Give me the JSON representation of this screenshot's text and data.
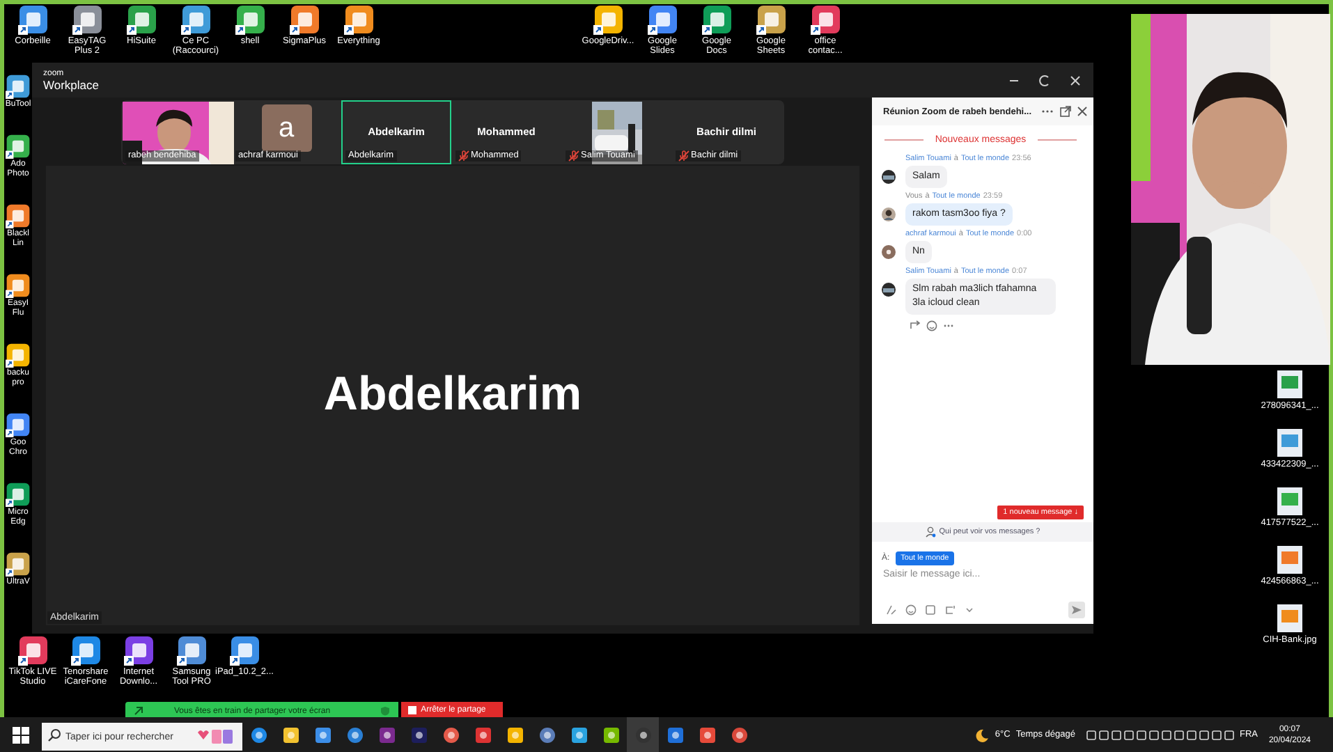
{
  "desktop": {
    "top_left_icons": [
      {
        "label": "Corbeille"
      },
      {
        "label": "EasyTAG Plus 2"
      },
      {
        "label": "HiSuite"
      },
      {
        "label": "Ce PC (Raccourci)"
      },
      {
        "label": "shell"
      },
      {
        "label": "SigmaPlus"
      },
      {
        "label": "Everything"
      }
    ],
    "top_right_icons": [
      {
        "label": "GoogleDriv..."
      },
      {
        "label": "Google Slides"
      },
      {
        "label": "Google Docs"
      },
      {
        "label": "Google Sheets"
      },
      {
        "label": "office contac..."
      }
    ],
    "left_icons": [
      {
        "label": "BuTool"
      },
      {
        "label": "Ado Photo"
      },
      {
        "label": "Blackl Lin"
      },
      {
        "label": "EasyI Flu"
      },
      {
        "label": "backu pro"
      },
      {
        "label": "Goo Chro"
      },
      {
        "label": "Micro Edg"
      },
      {
        "label": "UltraV"
      }
    ],
    "bottom_icons": [
      {
        "label": "TikTok LIVE Studio"
      },
      {
        "label": "Tenorshare iCareFone"
      },
      {
        "label": "Internet Downlo..."
      },
      {
        "label": "Samsung Tool PRO"
      },
      {
        "label": "iPad_10.2_2..."
      }
    ],
    "right_icons": [
      {
        "label": "278096341_..."
      },
      {
        "label": "433422309_..."
      },
      {
        "label": "417577522_..."
      },
      {
        "label": "424566863_..."
      },
      {
        "label": "CIH-Bank.jpg"
      }
    ]
  },
  "zoom_window": {
    "brand": "zoom",
    "title": "Workplace",
    "participants": [
      {
        "kind": "video",
        "label": "rabeh bendehiba",
        "muted": false,
        "selected": false
      },
      {
        "kind": "avatar",
        "initial": "a",
        "label": "achraf karmoui",
        "muted": false,
        "selected": false
      },
      {
        "kind": "name",
        "name": "Abdelkarim",
        "label": "Abdelkarim",
        "muted": false,
        "selected": true
      },
      {
        "kind": "name",
        "name": "Mohammed",
        "label": "Mohammed",
        "muted": true,
        "selected": false
      },
      {
        "kind": "video",
        "label": "Salim Touami",
        "muted": true,
        "selected": false
      },
      {
        "kind": "name",
        "name": "Bachir dilmi",
        "label": "Bachir dilmi",
        "muted": true,
        "selected": false
      }
    ],
    "main_tile": {
      "name": "Abdelkarim",
      "label": "Abdelkarim"
    }
  },
  "chat": {
    "title": "Réunion Zoom de rabeh bendehi...",
    "divider": "Nouveaux messages",
    "messages": [
      {
        "sender": "Salim Touami",
        "connector": "à",
        "recipient": "Tout le monde",
        "time": "23:56",
        "text": "Salam",
        "mine": false
      },
      {
        "sender": "Vous",
        "connector": "à",
        "recipient": "Tout le monde",
        "time": "23:59",
        "text": "rakom tasm3oo fiya ?",
        "mine": true
      },
      {
        "sender": "achraf karmoui",
        "connector": "à",
        "recipient": "Tout le monde",
        "time": "0:00",
        "text": "Nn",
        "mine": false
      },
      {
        "sender": "Salim Touami",
        "connector": "à",
        "recipient": "Tout le monde",
        "time": "0:07",
        "text": "Slm rabah ma3lich tfahamna 3la icloud clean",
        "mine": false
      }
    ],
    "new_message_button": "1 nouveau message ↓",
    "privacy_note": "Qui peut voir vos messages ?",
    "to_label": "À:",
    "recipient_button": "Tout le monde",
    "input_placeholder": "Saisir le message ici..."
  },
  "share_bar": {
    "message": "Vous êtes en train de partager votre écran",
    "stop_button": "Arrêter le partage"
  },
  "taskbar": {
    "search_placeholder": "Taper ici pour rechercher",
    "temperature": "6°C",
    "weather": "Temps dégagé",
    "language": "FRA",
    "time": "00:07",
    "date": "20/04/2024"
  }
}
